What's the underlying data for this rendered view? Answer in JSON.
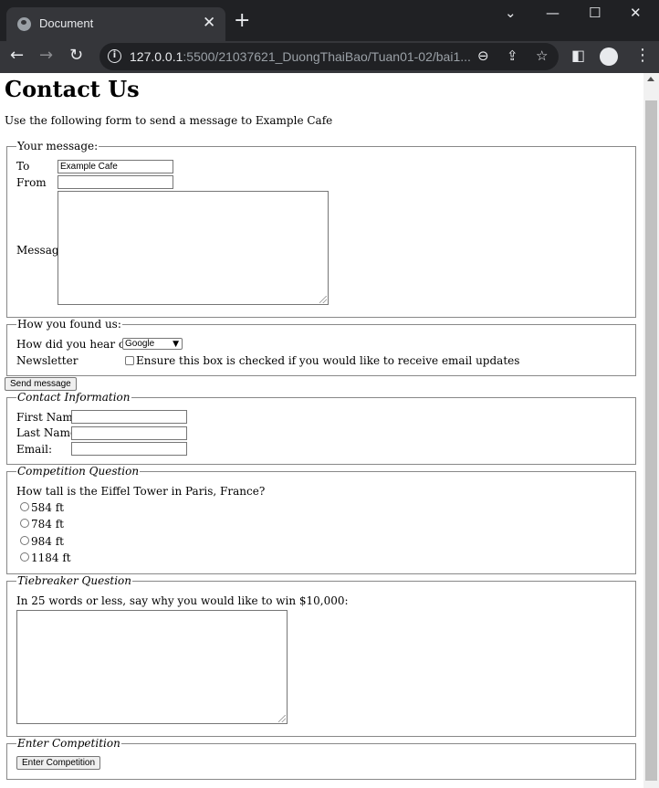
{
  "browser": {
    "tab_title": "Document",
    "url_host": "127.0.0.1",
    "url_path": ":5500/21037621_DuongThaiBao/Tuan01-02/bai1..."
  },
  "page": {
    "title": "Contact Us",
    "intro": "Use the following form to send a message to Example Cafe"
  },
  "message_fieldset": {
    "legend": "Your message:",
    "to_label": "To",
    "to_value": "Example Cafe",
    "from_label": "From",
    "from_value": "",
    "message_label": "Message",
    "message_value": ""
  },
  "found_us_fieldset": {
    "legend": "How you found us:",
    "hear_label": "How did you hear of us",
    "hear_selected": "Google",
    "newsletter_label": "Newsletter",
    "newsletter_checked": false,
    "newsletter_text": "Ensure this box is checked if you would like to receive email updates"
  },
  "send_button": "Send message",
  "contact_fieldset": {
    "legend": "Contact Information",
    "first_name_label": "First Name:",
    "last_name_label": "Last Name:",
    "email_label": "Email:"
  },
  "competition_fieldset": {
    "legend": "Competition Question",
    "question": "How tall is the Eiffel Tower in Paris, France?",
    "options": [
      "584 ft",
      "784 ft",
      "984 ft",
      "1184 ft"
    ]
  },
  "tiebreaker_fieldset": {
    "legend": "Tiebreaker Question",
    "prompt": "In 25 words or less, say why you would like to win $10,000:"
  },
  "enter_fieldset": {
    "legend": "Enter Competition",
    "button": "Enter Competition"
  }
}
